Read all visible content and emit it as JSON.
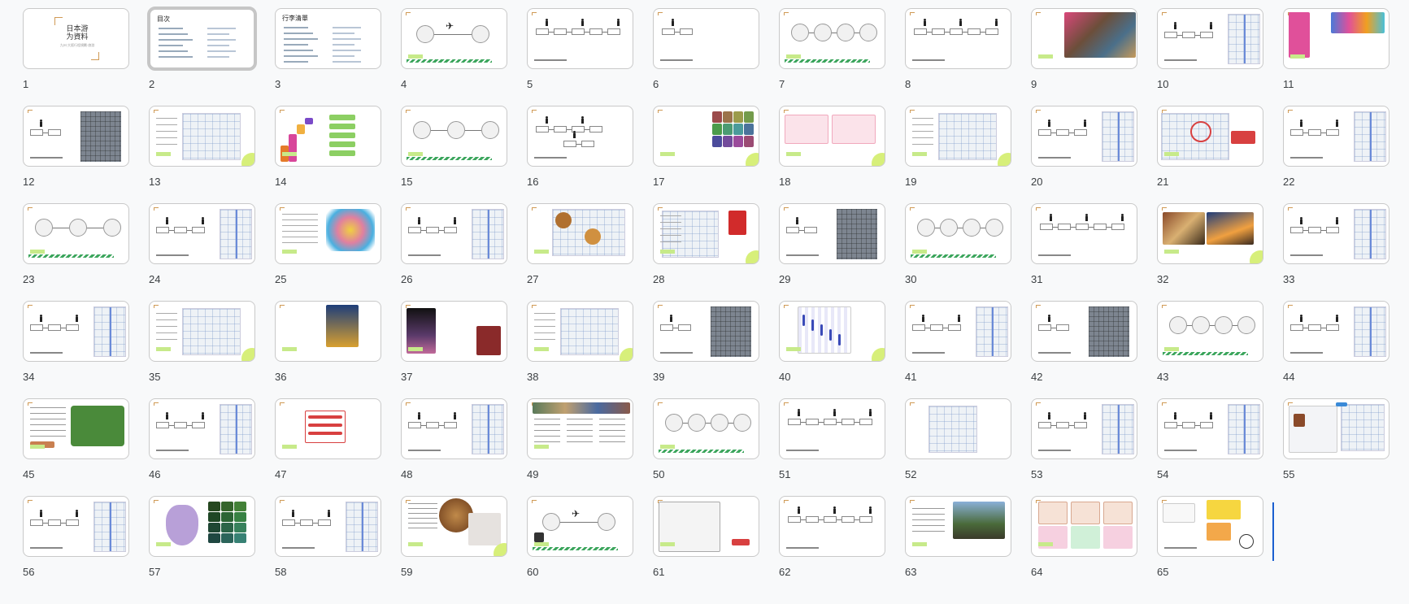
{
  "app": {
    "view": "slide-grid",
    "selected_slide": "2"
  },
  "slides": [
    {
      "n": "1",
      "kind": "title",
      "title": "日本游\n为資料",
      "subtitle": "九州·大阪行程規劃·旅游"
    },
    {
      "n": "2",
      "kind": "toc",
      "title": "目次"
    },
    {
      "n": "3",
      "kind": "list",
      "title": "行李清單"
    },
    {
      "n": "4",
      "kind": "flight"
    },
    {
      "n": "5",
      "kind": "route"
    },
    {
      "n": "6",
      "kind": "route-short"
    },
    {
      "n": "7",
      "kind": "circles"
    },
    {
      "n": "8",
      "kind": "route"
    },
    {
      "n": "9",
      "kind": "photos"
    },
    {
      "n": "10",
      "kind": "route-map"
    },
    {
      "n": "11",
      "kind": "collage"
    },
    {
      "n": "12",
      "kind": "route-aerial"
    },
    {
      "n": "13",
      "kind": "map-notes"
    },
    {
      "n": "14",
      "kind": "chart"
    },
    {
      "n": "15",
      "kind": "circles3"
    },
    {
      "n": "16",
      "kind": "route-branch"
    },
    {
      "n": "17",
      "kind": "photogrid"
    },
    {
      "n": "18",
      "kind": "pinkmaps"
    },
    {
      "n": "19",
      "kind": "map-notes"
    },
    {
      "n": "20",
      "kind": "route-map"
    },
    {
      "n": "21",
      "kind": "red-map"
    },
    {
      "n": "22",
      "kind": "route-map"
    },
    {
      "n": "23",
      "kind": "circles3"
    },
    {
      "n": "24",
      "kind": "route-map"
    },
    {
      "n": "25",
      "kind": "colormap"
    },
    {
      "n": "26",
      "kind": "route-map"
    },
    {
      "n": "27",
      "kind": "food-map"
    },
    {
      "n": "28",
      "kind": "map-red"
    },
    {
      "n": "29",
      "kind": "route-aerial"
    },
    {
      "n": "30",
      "kind": "circles"
    },
    {
      "n": "31",
      "kind": "route"
    },
    {
      "n": "32",
      "kind": "photos2"
    },
    {
      "n": "33",
      "kind": "route-map"
    },
    {
      "n": "34",
      "kind": "route-map"
    },
    {
      "n": "35",
      "kind": "map-notes"
    },
    {
      "n": "36",
      "kind": "poster"
    },
    {
      "n": "37",
      "kind": "night-photo"
    },
    {
      "n": "38",
      "kind": "map-notes"
    },
    {
      "n": "39",
      "kind": "route-aerial"
    },
    {
      "n": "40",
      "kind": "timetable"
    },
    {
      "n": "41",
      "kind": "route-map"
    },
    {
      "n": "42",
      "kind": "route-aerial"
    },
    {
      "n": "43",
      "kind": "circles"
    },
    {
      "n": "44",
      "kind": "route-map"
    },
    {
      "n": "45",
      "kind": "green-map"
    },
    {
      "n": "46",
      "kind": "route-map"
    },
    {
      "n": "47",
      "kind": "red-doc"
    },
    {
      "n": "48",
      "kind": "route-map"
    },
    {
      "n": "49",
      "kind": "photo-banner"
    },
    {
      "n": "50",
      "kind": "circles"
    },
    {
      "n": "51",
      "kind": "route"
    },
    {
      "n": "52",
      "kind": "map-only"
    },
    {
      "n": "53",
      "kind": "route-map"
    },
    {
      "n": "54",
      "kind": "route-map"
    },
    {
      "n": "55",
      "kind": "web-map"
    },
    {
      "n": "56",
      "kind": "route-map"
    },
    {
      "n": "57",
      "kind": "purple-map"
    },
    {
      "n": "58",
      "kind": "route-map"
    },
    {
      "n": "59",
      "kind": "food-photo"
    },
    {
      "n": "60",
      "kind": "flight-qr"
    },
    {
      "n": "61",
      "kind": "sketch"
    },
    {
      "n": "62",
      "kind": "route"
    },
    {
      "n": "63",
      "kind": "shrine"
    },
    {
      "n": "64",
      "kind": "cards"
    },
    {
      "n": "65",
      "kind": "yellow"
    }
  ],
  "colors": {
    "accent_green": "#3ba55c",
    "lime": "#d7ef7a",
    "selection_border": "#c6c6c6",
    "cursor": "#1a5fd0"
  }
}
